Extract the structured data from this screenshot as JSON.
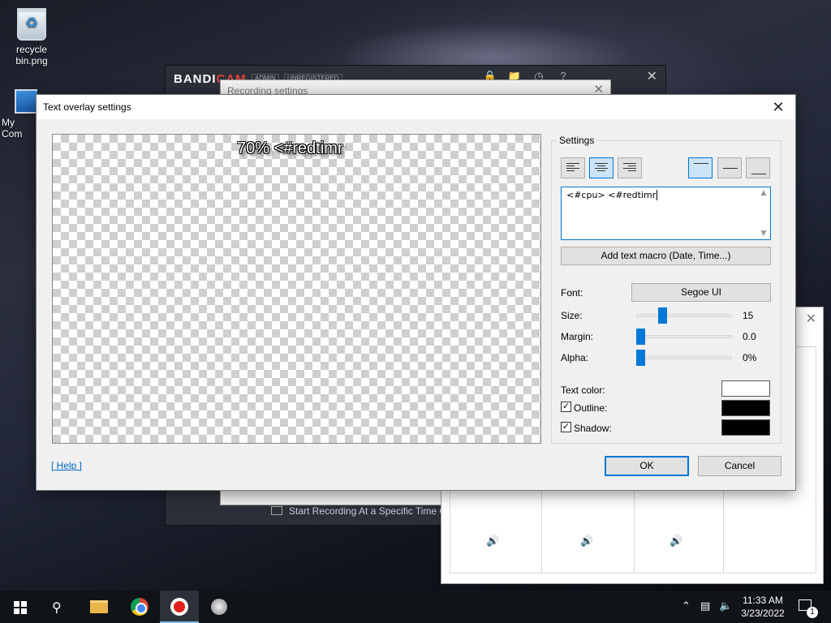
{
  "desktop": {
    "icons": [
      {
        "label": "recycle bin.png"
      },
      {
        "label": "My Com"
      }
    ]
  },
  "bandicam": {
    "brand": "BANDICAM",
    "brand_main": "BANDI",
    "brand_accent": "CAM",
    "badge_admin": "ADMIN",
    "badge_unreg": "UNREGISTERED",
    "bottom_text": "Start Recording At a Specific Time On a Daily/Weekly schedule"
  },
  "recording_settings": {
    "title": "Recording settings"
  },
  "dialog": {
    "title": "Text overlay settings",
    "preview_text": "70% <#redtimr",
    "settings_label": "Settings",
    "text_value": "<#cpu> <#redtimr",
    "macro_button": "Add text macro (Date, Time...)",
    "font_label": "Font:",
    "font_value": "Segoe UI",
    "size_label": "Size:",
    "size_value": "15",
    "margin_label": "Margin:",
    "margin_value": "0.0",
    "alpha_label": "Alpha:",
    "alpha_value": "0%",
    "text_color_label": "Text color:",
    "outline_label": "Outline:",
    "shadow_label": "Shadow:",
    "outline_checked": true,
    "shadow_checked": true,
    "text_color": "#ffffff",
    "outline_color": "#000000",
    "shadow_color": "#000000",
    "help_link": "[ Help ]",
    "ok_button": "OK",
    "cancel_button": "Cancel"
  },
  "taskbar": {
    "time": "11:33 AM",
    "date": "3/23/2022",
    "notification_count": "1"
  }
}
